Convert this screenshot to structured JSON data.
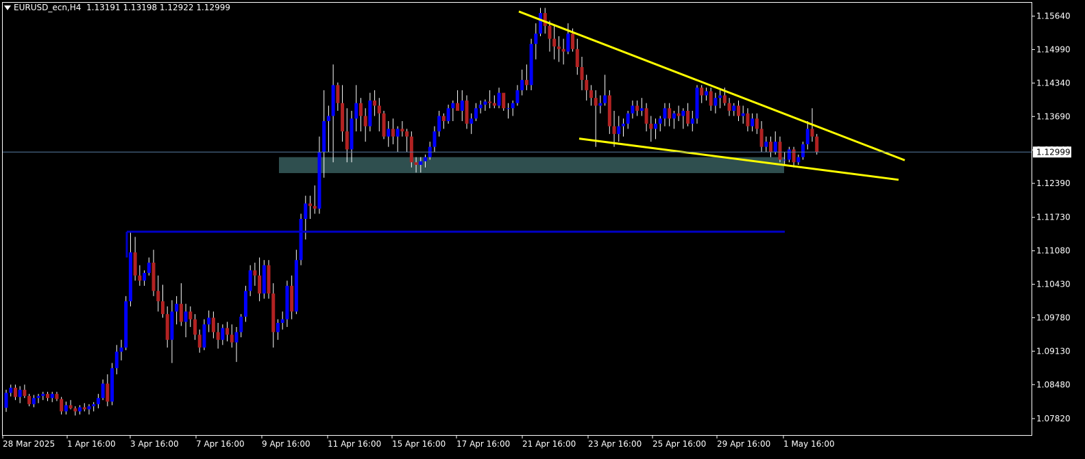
{
  "header": {
    "symbol": "EURUSD_ecn,H4",
    "ohlc": "1.13191 1.13198 1.12922 1.12999"
  },
  "current_price_label": "1.12999",
  "colors": {
    "background": "#000000",
    "border": "#ffffff",
    "bull": "#0000ff",
    "bear": "#b22222",
    "wick": "#ffffff",
    "trendline": "#ffff00",
    "hline": "#0000c8",
    "zone": "#2f4f4f",
    "current_line": "#5b7fa6"
  },
  "chart_data": {
    "type": "candlestick",
    "title": "EURUSD_ecn,H4",
    "ylim": [
      1.075,
      1.159
    ],
    "y_ticks": [
      "1.15640",
      "1.14990",
      "1.14340",
      "1.13690",
      "1.13040",
      "1.12390",
      "1.11730",
      "1.11080",
      "1.10430",
      "1.09780",
      "1.09130",
      "1.08480",
      "1.07820"
    ],
    "x_ticks": [
      "28 Mar 2025",
      "1 Apr 16:00",
      "3 Apr 16:00",
      "7 Apr 16:00",
      "9 Apr 16:00",
      "11 Apr 16:00",
      "15 Apr 16:00",
      "17 Apr 16:00",
      "21 Apr 16:00",
      "23 Apr 16:00",
      "25 Apr 16:00",
      "29 Apr 16:00",
      "1 May 16:00"
    ],
    "current_price": 1.12999,
    "candles": [
      [
        1.0803,
        1.0838,
        1.0795,
        1.0832
      ],
      [
        1.0832,
        1.0848,
        1.0825,
        1.0842
      ],
      [
        1.0842,
        1.0848,
        1.0818,
        1.0824
      ],
      [
        1.0824,
        1.0845,
        1.0812,
        1.0838
      ],
      [
        1.0838,
        1.0848,
        1.0822,
        1.0826
      ],
      [
        1.0826,
        1.083,
        1.0806,
        1.081
      ],
      [
        1.081,
        1.0828,
        1.0804,
        1.0822
      ],
      [
        1.0822,
        1.083,
        1.0812,
        1.0826
      ],
      [
        1.0826,
        1.0834,
        1.0818,
        1.083
      ],
      [
        1.083,
        1.0834,
        1.0816,
        1.0822
      ],
      [
        1.0822,
        1.0834,
        1.0814,
        1.083
      ],
      [
        1.083,
        1.0834,
        1.0816,
        1.082
      ],
      [
        1.082,
        1.0824,
        1.079,
        1.0796
      ],
      [
        1.0796,
        1.0815,
        1.079,
        1.0808
      ],
      [
        1.0808,
        1.0818,
        1.08,
        1.0802
      ],
      [
        1.0802,
        1.0806,
        1.0788,
        1.0796
      ],
      [
        1.0796,
        1.0808,
        1.079,
        1.0804
      ],
      [
        1.0804,
        1.0812,
        1.0796,
        1.08
      ],
      [
        1.08,
        1.081,
        1.079,
        1.0806
      ],
      [
        1.0806,
        1.0814,
        1.0796,
        1.081
      ],
      [
        1.081,
        1.083,
        1.0802,
        1.0822
      ],
      [
        1.0822,
        1.0858,
        1.0818,
        1.085
      ],
      [
        1.085,
        1.0868,
        1.0806,
        1.0815
      ],
      [
        1.0815,
        1.089,
        1.0808,
        1.088
      ],
      [
        1.088,
        1.0925,
        1.0868,
        1.0912
      ],
      [
        1.0912,
        1.0935,
        1.0895,
        1.092
      ],
      [
        1.092,
        1.102,
        1.0915,
        1.101
      ],
      [
        1.101,
        1.1145,
        1.1,
        1.1105
      ],
      [
        1.1105,
        1.1135,
        1.105,
        1.106
      ],
      [
        1.106,
        1.108,
        1.104,
        1.105
      ],
      [
        1.105,
        1.107,
        1.104,
        1.1065
      ],
      [
        1.1065,
        1.1095,
        1.106,
        1.1085
      ],
      [
        1.1085,
        1.111,
        1.102,
        1.103
      ],
      [
        1.103,
        1.106,
        1.099,
        1.101
      ],
      [
        1.101,
        1.1042,
        1.0978,
        1.0985
      ],
      [
        1.0985,
        1.1,
        1.092,
        1.0935
      ],
      [
        1.0935,
        1.1012,
        1.089,
        1.099
      ],
      [
        1.099,
        1.102,
        1.0965,
        1.1005
      ],
      [
        1.1005,
        1.1045,
        1.0962,
        1.097
      ],
      [
        1.097,
        1.1005,
        1.094,
        1.099
      ],
      [
        1.099,
        1.1,
        1.096,
        1.0975
      ],
      [
        1.0975,
        1.0985,
        1.0935,
        1.0945
      ],
      [
        1.0945,
        1.0955,
        1.091,
        1.092
      ],
      [
        1.092,
        1.0975,
        1.0915,
        1.0965
      ],
      [
        1.0965,
        1.0992,
        1.095,
        1.0978
      ],
      [
        1.0978,
        1.099,
        1.0938,
        1.095
      ],
      [
        1.095,
        1.0968,
        1.0918,
        1.0935
      ],
      [
        1.0935,
        1.0965,
        1.0925,
        1.0958
      ],
      [
        1.0958,
        1.097,
        1.0932,
        1.0945
      ],
      [
        1.0945,
        1.0965,
        1.092,
        1.093
      ],
      [
        1.093,
        1.096,
        1.0892,
        1.095
      ],
      [
        1.095,
        1.0985,
        1.094,
        1.098
      ],
      [
        1.098,
        1.104,
        1.097,
        1.103
      ],
      [
        1.103,
        1.108,
        1.102,
        1.107
      ],
      [
        1.107,
        1.1085,
        1.104,
        1.106
      ],
      [
        1.106,
        1.1095,
        1.101,
        1.1025
      ],
      [
        1.1025,
        1.109,
        1.1015,
        1.108
      ],
      [
        1.108,
        1.109,
        1.1015,
        1.1025
      ],
      [
        1.1025,
        1.1045,
        1.092,
        1.095
      ],
      [
        1.095,
        1.0975,
        1.0935,
        1.0968
      ],
      [
        1.0968,
        1.099,
        1.0955,
        1.0975
      ],
      [
        1.0975,
        1.105,
        1.096,
        1.104
      ],
      [
        1.104,
        1.106,
        1.0975,
        1.099
      ],
      [
        1.099,
        1.111,
        1.0985,
        1.109
      ],
      [
        1.109,
        1.118,
        1.108,
        1.117
      ],
      [
        1.117,
        1.1215,
        1.113,
        1.12
      ],
      [
        1.12,
        1.1215,
        1.117,
        1.1195
      ],
      [
        1.1195,
        1.1235,
        1.118,
        1.119
      ],
      [
        1.119,
        1.133,
        1.118,
        1.13
      ],
      [
        1.13,
        1.142,
        1.125,
        1.136
      ],
      [
        1.136,
        1.139,
        1.13,
        1.137
      ],
      [
        1.137,
        1.147,
        1.128,
        1.143
      ],
      [
        1.143,
        1.1435,
        1.138,
        1.1395
      ],
      [
        1.1395,
        1.143,
        1.132,
        1.134
      ],
      [
        1.134,
        1.1385,
        1.128,
        1.1305
      ],
      [
        1.1305,
        1.138,
        1.128,
        1.1365
      ],
      [
        1.1365,
        1.143,
        1.134,
        1.1395
      ],
      [
        1.1395,
        1.1405,
        1.134,
        1.137
      ],
      [
        1.137,
        1.1385,
        1.132,
        1.135
      ],
      [
        1.135,
        1.1415,
        1.134,
        1.14
      ],
      [
        1.14,
        1.142,
        1.137,
        1.139
      ],
      [
        1.139,
        1.1405,
        1.134,
        1.1375
      ],
      [
        1.1375,
        1.138,
        1.1325,
        1.133
      ],
      [
        1.133,
        1.136,
        1.131,
        1.1345
      ],
      [
        1.1345,
        1.1365,
        1.1315,
        1.133
      ],
      [
        1.133,
        1.135,
        1.13,
        1.1345
      ],
      [
        1.1345,
        1.136,
        1.133,
        1.134
      ],
      [
        1.134,
        1.1345,
        1.13,
        1.133
      ],
      [
        1.133,
        1.134,
        1.127,
        1.128
      ],
      [
        1.128,
        1.129,
        1.126,
        1.1275
      ],
      [
        1.1275,
        1.129,
        1.126,
        1.1282
      ],
      [
        1.1282,
        1.1295,
        1.127,
        1.129
      ],
      [
        1.129,
        1.132,
        1.1285,
        1.131
      ],
      [
        1.131,
        1.135,
        1.13,
        1.134
      ],
      [
        1.134,
        1.138,
        1.133,
        1.137
      ],
      [
        1.137,
        1.1375,
        1.1345,
        1.136
      ],
      [
        1.136,
        1.1392,
        1.1355,
        1.1385
      ],
      [
        1.1385,
        1.14,
        1.136,
        1.1395
      ],
      [
        1.1395,
        1.142,
        1.138,
        1.138
      ],
      [
        1.138,
        1.142,
        1.136,
        1.14
      ],
      [
        1.14,
        1.141,
        1.1345,
        1.1355
      ],
      [
        1.1355,
        1.1375,
        1.1335,
        1.1365
      ],
      [
        1.1365,
        1.1395,
        1.136,
        1.1385
      ],
      [
        1.1385,
        1.14,
        1.1375,
        1.1392
      ],
      [
        1.1392,
        1.1402,
        1.138,
        1.1398
      ],
      [
        1.1398,
        1.142,
        1.1385,
        1.1395
      ],
      [
        1.1395,
        1.141,
        1.1385,
        1.139
      ],
      [
        1.139,
        1.1425,
        1.1385,
        1.1415
      ],
      [
        1.1415,
        1.141,
        1.138,
        1.1385
      ],
      [
        1.1385,
        1.1395,
        1.1365,
        1.1385
      ],
      [
        1.1385,
        1.14,
        1.137,
        1.1395
      ],
      [
        1.1395,
        1.143,
        1.139,
        1.142
      ],
      [
        1.142,
        1.146,
        1.141,
        1.144
      ],
      [
        1.144,
        1.147,
        1.142,
        1.143
      ],
      [
        1.143,
        1.152,
        1.142,
        1.151
      ],
      [
        1.151,
        1.155,
        1.148,
        1.153
      ],
      [
        1.153,
        1.158,
        1.1525,
        1.157
      ],
      [
        1.157,
        1.158,
        1.153,
        1.1545
      ],
      [
        1.1545,
        1.1555,
        1.1495,
        1.152
      ],
      [
        1.152,
        1.1545,
        1.148,
        1.1505
      ],
      [
        1.1505,
        1.1525,
        1.1475,
        1.15
      ],
      [
        1.15,
        1.152,
        1.147,
        1.1495
      ],
      [
        1.1495,
        1.155,
        1.149,
        1.153
      ],
      [
        1.153,
        1.154,
        1.1495,
        1.15
      ],
      [
        1.15,
        1.152,
        1.145,
        1.1465
      ],
      [
        1.1465,
        1.1485,
        1.142,
        1.144
      ],
      [
        1.144,
        1.145,
        1.14,
        1.142
      ],
      [
        1.142,
        1.143,
        1.139,
        1.1405
      ],
      [
        1.1405,
        1.142,
        1.131,
        1.139
      ],
      [
        1.139,
        1.141,
        1.1375,
        1.1395
      ],
      [
        1.1395,
        1.145,
        1.139,
        1.141
      ],
      [
        1.141,
        1.142,
        1.1335,
        1.135
      ],
      [
        1.135,
        1.138,
        1.131,
        1.1335
      ],
      [
        1.1335,
        1.137,
        1.132,
        1.135
      ],
      [
        1.135,
        1.1365,
        1.133,
        1.1355
      ],
      [
        1.1355,
        1.138,
        1.1345,
        1.1375
      ],
      [
        1.1375,
        1.14,
        1.1365,
        1.139
      ],
      [
        1.139,
        1.14,
        1.137,
        1.138
      ],
      [
        1.138,
        1.1405,
        1.137,
        1.1385
      ],
      [
        1.1385,
        1.1395,
        1.134,
        1.1355
      ],
      [
        1.1355,
        1.137,
        1.132,
        1.1345
      ],
      [
        1.1345,
        1.1365,
        1.1325,
        1.1355
      ],
      [
        1.1355,
        1.137,
        1.134,
        1.1365
      ],
      [
        1.1365,
        1.1395,
        1.135,
        1.1385
      ],
      [
        1.1385,
        1.1395,
        1.135,
        1.1365
      ],
      [
        1.1365,
        1.138,
        1.1345,
        1.1375
      ],
      [
        1.1375,
        1.139,
        1.136,
        1.137
      ],
      [
        1.137,
        1.1385,
        1.1345,
        1.138
      ],
      [
        1.138,
        1.1395,
        1.135,
        1.1355
      ],
      [
        1.1355,
        1.138,
        1.134,
        1.1365
      ],
      [
        1.1365,
        1.143,
        1.1355,
        1.1425
      ],
      [
        1.1425,
        1.143,
        1.1395,
        1.141
      ],
      [
        1.141,
        1.1425,
        1.14,
        1.1418
      ],
      [
        1.1418,
        1.1425,
        1.138,
        1.139
      ],
      [
        1.139,
        1.1415,
        1.1375,
        1.1405
      ],
      [
        1.1405,
        1.142,
        1.1385,
        1.141
      ],
      [
        1.141,
        1.1425,
        1.139,
        1.1395
      ],
      [
        1.1395,
        1.1405,
        1.137,
        1.138
      ],
      [
        1.138,
        1.1395,
        1.137,
        1.139
      ],
      [
        1.139,
        1.14,
        1.136,
        1.137
      ],
      [
        1.137,
        1.139,
        1.1355,
        1.1375
      ],
      [
        1.1375,
        1.1385,
        1.134,
        1.135
      ],
      [
        1.135,
        1.1375,
        1.134,
        1.1365
      ],
      [
        1.1365,
        1.1375,
        1.1335,
        1.1345
      ],
      [
        1.1345,
        1.136,
        1.13,
        1.131
      ],
      [
        1.131,
        1.133,
        1.13,
        1.132
      ],
      [
        1.132,
        1.133,
        1.129,
        1.13
      ],
      [
        1.13,
        1.134,
        1.1295,
        1.132
      ],
      [
        1.132,
        1.133,
        1.128,
        1.1285
      ],
      [
        1.1285,
        1.13,
        1.1275,
        1.1285
      ],
      [
        1.1285,
        1.131,
        1.128,
        1.1305
      ],
      [
        1.1305,
        1.131,
        1.127,
        1.128
      ],
      [
        1.128,
        1.1295,
        1.1275,
        1.129
      ],
      [
        1.129,
        1.132,
        1.1285,
        1.1315
      ],
      [
        1.1315,
        1.136,
        1.1305,
        1.1345
      ],
      [
        1.1345,
        1.1385,
        1.132,
        1.133
      ],
      [
        1.133,
        1.1335,
        1.1295,
        1.13
      ]
    ]
  }
}
